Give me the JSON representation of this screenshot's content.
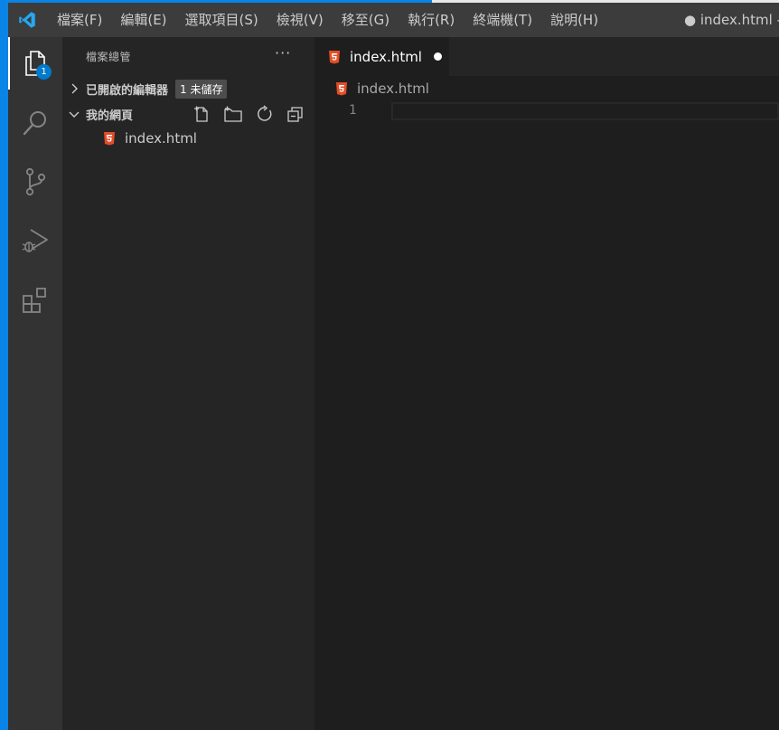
{
  "titlebar": {
    "menu": [
      "檔案(F)",
      "編輯(E)",
      "選取項目(S)",
      "檢視(V)",
      "移至(G)",
      "執行(R)",
      "終端機(T)",
      "說明(H)"
    ],
    "window_title": "● index.html - 我"
  },
  "activitybar": {
    "explorer_badge": "1"
  },
  "sidebar": {
    "title": "檔案總管",
    "more": "···",
    "open_editors": {
      "label": "已開啟的編輯器",
      "badge": "1 未儲存"
    },
    "folder": {
      "label": "我的網頁"
    },
    "files": [
      {
        "name": "index.html"
      }
    ]
  },
  "editor": {
    "tab": {
      "label": "index.html"
    },
    "breadcrumb": "index.html",
    "line_number": "1"
  },
  "colors": {
    "accent": "#007acc",
    "html_icon": "#e44d26"
  }
}
